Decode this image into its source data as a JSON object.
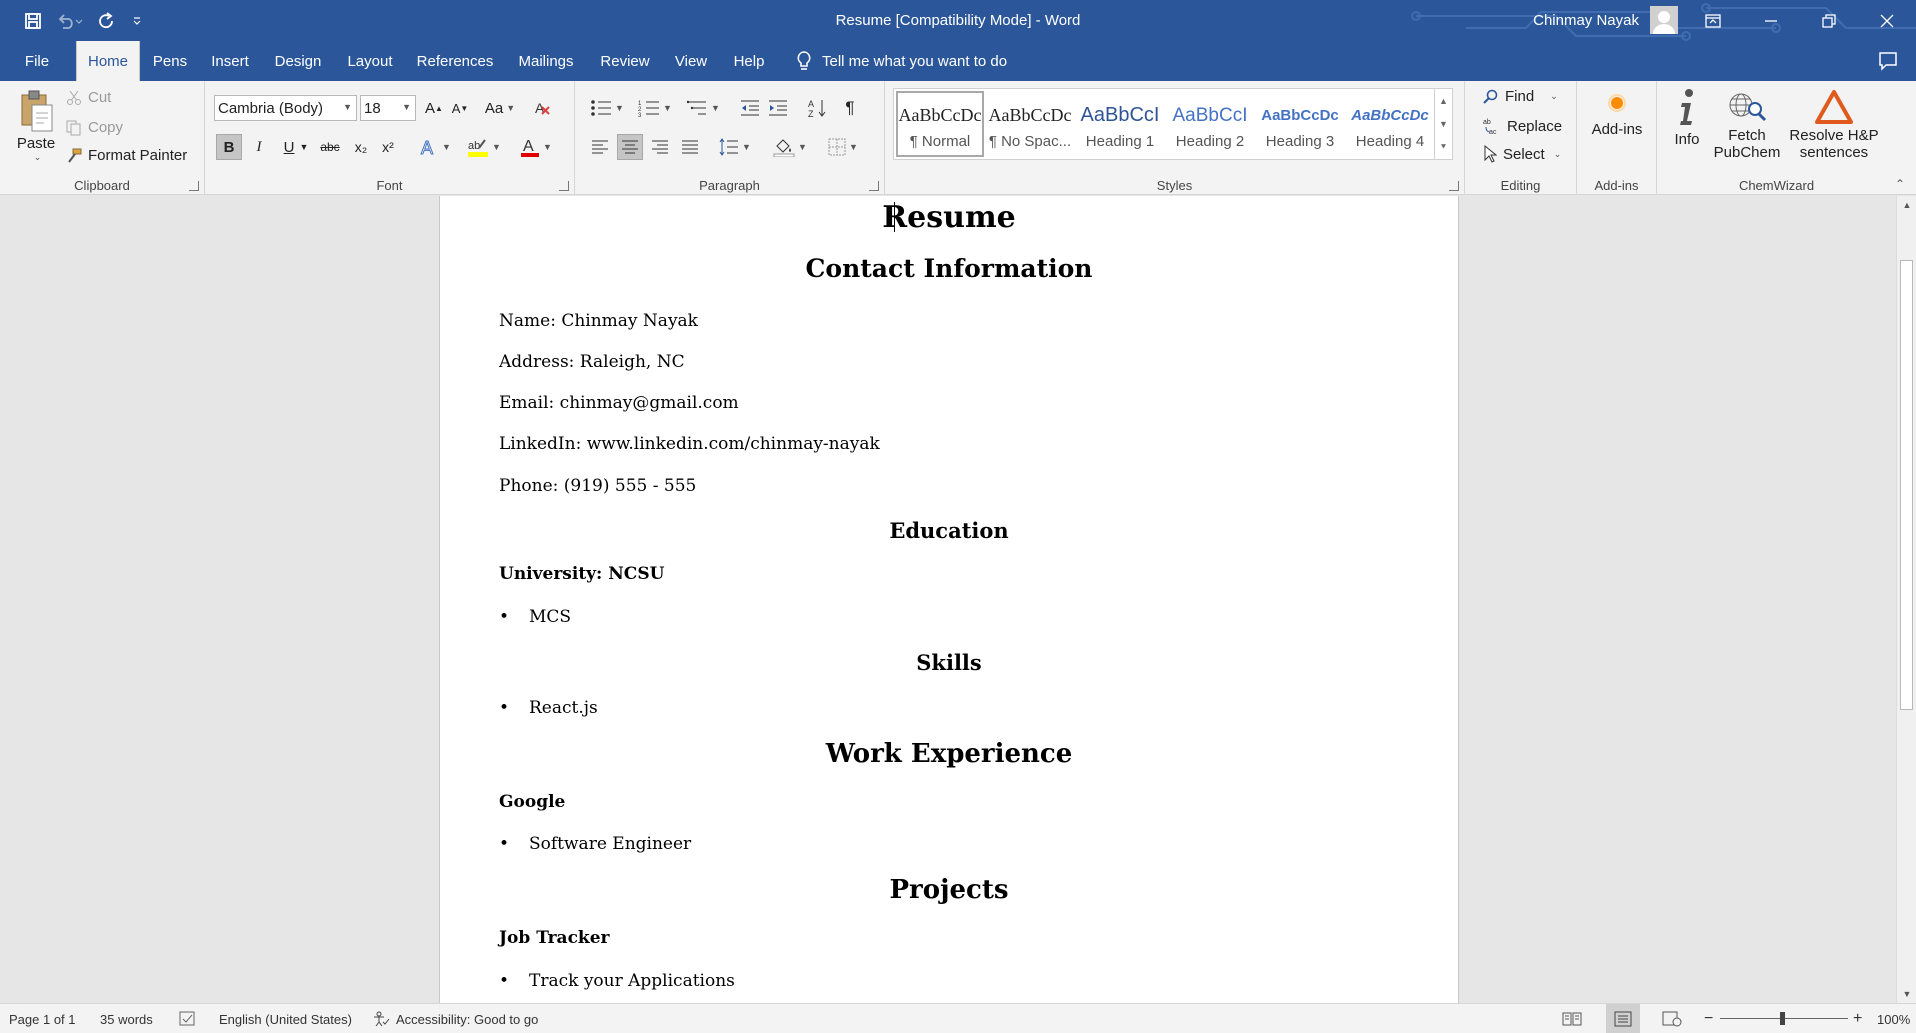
{
  "window": {
    "title": "Resume [Compatibility Mode]  -  Word",
    "account_name": "Chinmay Nayak"
  },
  "tabs": [
    {
      "label": "File"
    },
    {
      "label": "Home"
    },
    {
      "label": "Pens"
    },
    {
      "label": "Insert"
    },
    {
      "label": "Design"
    },
    {
      "label": "Layout"
    },
    {
      "label": "References"
    },
    {
      "label": "Mailings"
    },
    {
      "label": "Review"
    },
    {
      "label": "View"
    },
    {
      "label": "Help"
    }
  ],
  "tell_me": "Tell me what you want to do",
  "ribbon": {
    "clipboard": {
      "label": "Clipboard",
      "paste": "Paste",
      "cut": "Cut",
      "copy": "Copy",
      "format_painter": "Format Painter"
    },
    "font": {
      "label": "Font",
      "font_name": "Cambria (Body)",
      "font_size": "18",
      "bold": "B",
      "italic": "I",
      "underline": "U",
      "strike": "abc",
      "subscript": "x₂",
      "superscript": "x²",
      "change_case": "Aa",
      "grow": "A",
      "shrink": "A"
    },
    "paragraph": {
      "label": "Paragraph"
    },
    "styles": {
      "label": "Styles",
      "items": [
        {
          "sample": "AaBbCcDc",
          "name": "¶ Normal",
          "color": "#000000"
        },
        {
          "sample": "AaBbCcDc",
          "name": "¶ No Spac...",
          "color": "#000000"
        },
        {
          "sample": "AaBbCcI",
          "name": "Heading 1",
          "color": "#2f5496"
        },
        {
          "sample": "AaBbCcI",
          "name": "Heading 2",
          "color": "#4472c4"
        },
        {
          "sample": "AaBbCcDc",
          "name": "Heading 3",
          "color": "#4472c4"
        },
        {
          "sample": "AaBbCcDc",
          "name": "Heading 4",
          "color": "#4472c4"
        }
      ]
    },
    "editing": {
      "label": "Editing",
      "find": "Find",
      "replace": "Replace",
      "select": "Select"
    },
    "addins": {
      "label": "Add-ins",
      "addins": "Add-ins"
    },
    "chemwizard": {
      "label": "ChemWizard",
      "info": "Info",
      "fetch_line1": "Fetch",
      "fetch_line2": "PubChem",
      "resolve_line1": "Resolve H&P",
      "resolve_line2": "sentences"
    }
  },
  "document": {
    "title": "Resume",
    "contact_heading": "Contact Information",
    "name": "Name: Chinmay Nayak",
    "address": "Address: Raleigh, NC",
    "email": "Email: chinmay@gmail.com",
    "linkedin": "LinkedIn: www.linkedin.com/chinmay-nayak",
    "phone": "Phone: (919) 555 - 555",
    "education_heading": "Education",
    "university": "University: NCSU",
    "degree": "MCS",
    "skills_heading": "Skills",
    "skill_1": "React.js",
    "work_heading": "Work Experience",
    "company": "Google",
    "role": "Software Engineer",
    "projects_heading": "Projects",
    "project_name": "Job Tracker",
    "project_desc": "Track your Applications"
  },
  "status": {
    "page": "Page 1 of 1",
    "words": "35 words",
    "language": "English (United States)",
    "accessibility": "Accessibility: Good to go",
    "zoom": "100%"
  },
  "colors": {
    "accent": "#2b579a",
    "ribbon_bg": "#f3f3f3"
  }
}
